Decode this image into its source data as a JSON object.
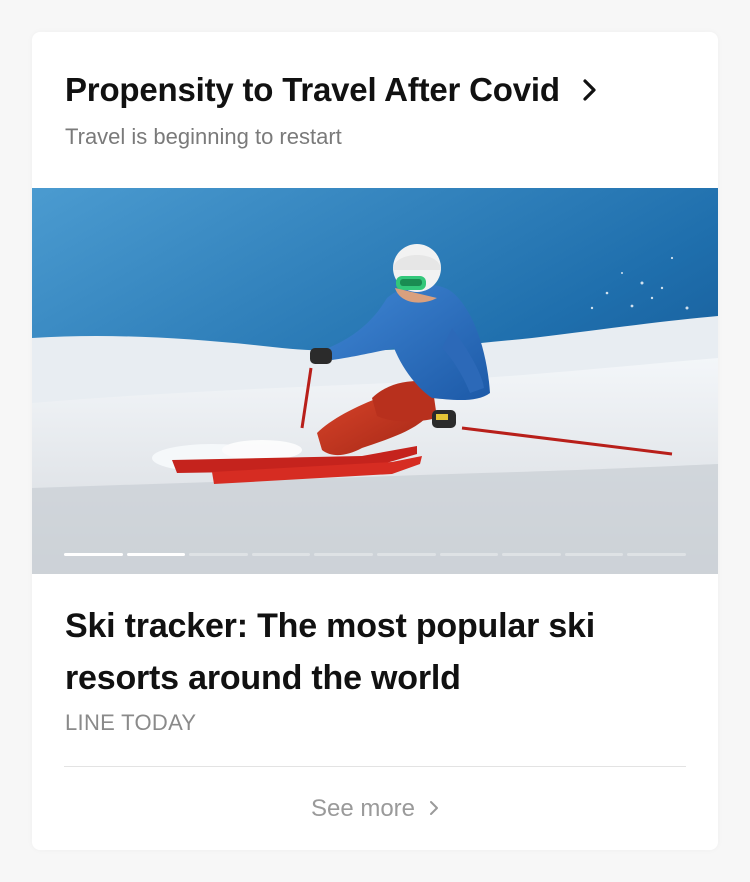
{
  "header": {
    "title": "Propensity to Travel After Covid",
    "subtitle": "Travel is beginning to restart"
  },
  "carousel": {
    "slide_count": 10,
    "current_slide": 2,
    "image_description_icon": "skier-photo"
  },
  "article": {
    "title": "Ski tracker: The most popular ski resorts around the world",
    "source": "LINE TODAY"
  },
  "footer": {
    "see_more_label": "See more"
  },
  "colors": {
    "title_text": "#111111",
    "subtitle_text": "#7a7a7a",
    "source_text": "#8a8a8a",
    "see_more_text": "#9a9a9a"
  }
}
